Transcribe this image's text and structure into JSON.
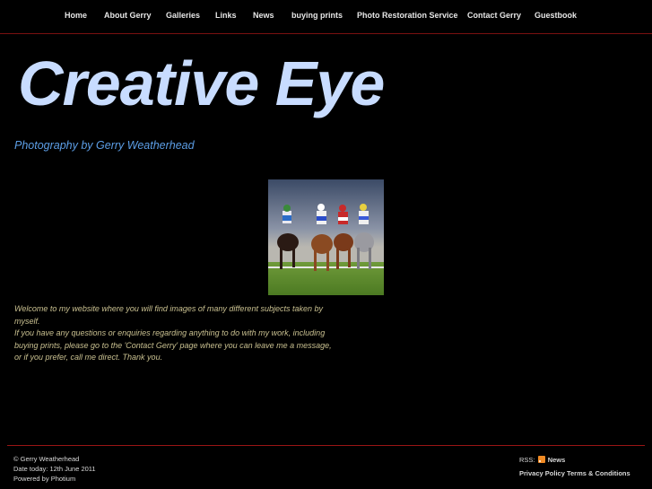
{
  "nav": {
    "items": [
      {
        "label": "Home"
      },
      {
        "label": "About Gerry"
      },
      {
        "label": "Galleries"
      },
      {
        "label": "Links"
      },
      {
        "label": "News"
      },
      {
        "label": "buying prints"
      },
      {
        "label": "Photo Restoration Service"
      },
      {
        "label": "Contact Gerry"
      },
      {
        "label": "Guestbook"
      }
    ]
  },
  "header": {
    "title": "Creative Eye",
    "tagline": "Photography by Gerry Weatherhead"
  },
  "main": {
    "welcome_line1": "Welcome to my website where you will find images of many different subjects taken by myself.",
    "welcome_line2": "If you have any questions or enquiries regarding anything to do with my work, including buying prints, please go to the 'Contact Gerry' page where you can leave me a message, or if you prefer, call me direct. Thank you."
  },
  "footer": {
    "copyright": "© Gerry Weatherhead",
    "date_text": "Date today: 12th June 2011",
    "powered": "Powered by Photium",
    "rss_label": "RSS:",
    "rss_link": "News",
    "privacy": "Privacy Policy",
    "terms": "Terms & Conditions"
  },
  "colors": {
    "accent_red": "#9a1515",
    "title_blue": "#c8dcff",
    "tagline_blue": "#5c9ee6",
    "welcome_text": "#c9c090"
  }
}
